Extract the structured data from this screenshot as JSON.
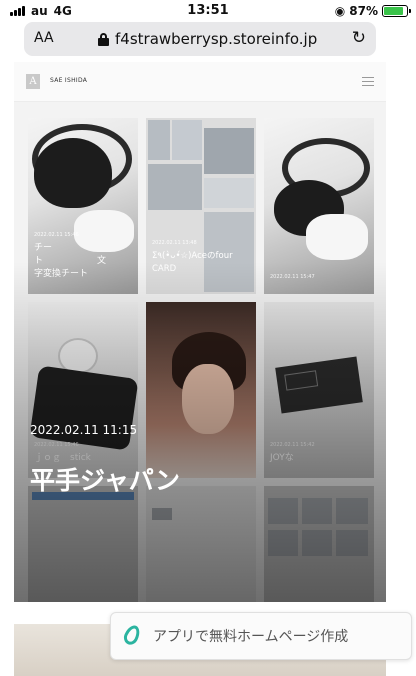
{
  "status_bar": {
    "carrier": "au",
    "network": "4G",
    "time": "13:51",
    "battery": "87%",
    "battery_level": 0.87
  },
  "browser": {
    "aa_label": "AA",
    "domain": "f4strawberrysp.storeinfo.jp"
  },
  "site": {
    "logo_letter": "A",
    "name": "SAE ISHIDA"
  },
  "tiles": [
    {
      "date": "2022.02.11 15:46",
      "title": "チー\nト　　　　　　文\n字変換チート"
    },
    {
      "date": "2022.02.11 13:48",
      "title": "Σ٩(•̀ᴗ•́☆)Aceのfour\nCARD"
    },
    {
      "date": "2022.02.11 15:47",
      "title": ""
    },
    {
      "date": "2022.02.11 15:46",
      "title": "ｊｏｇ　stick"
    },
    {
      "date": "",
      "title": ""
    },
    {
      "date": "2022.02.11 15:42",
      "title": "JOYな"
    }
  ],
  "featured": {
    "date": "2022.02.11 11:15",
    "title": "平手ジャパン"
  },
  "cta": {
    "label": "アプリで無料ホームページ作成"
  }
}
